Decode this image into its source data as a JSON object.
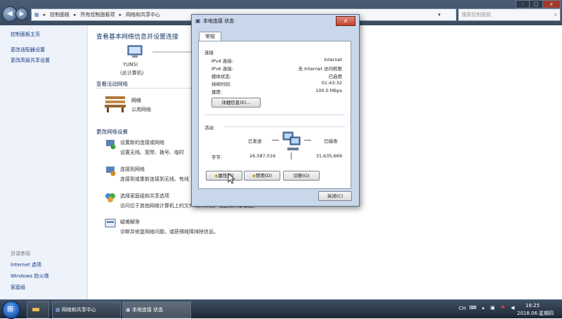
{
  "window": {
    "title_buttons": [
      "-",
      "□",
      "x"
    ],
    "breadcrumb": [
      "控制面板",
      "所有控制面板项",
      "网络和共享中心"
    ],
    "search_placeholder": "搜索控制面板"
  },
  "left_pane": {
    "links": [
      "控制面板主页",
      "更改适配器设置",
      "更改高级共享设置"
    ],
    "see_also_title": "另请参阅",
    "see_also": [
      "Internet 选项",
      "Windows 防火墙",
      "家庭组"
    ]
  },
  "main": {
    "title": "查看基本网络信息并设置连接",
    "computer_name": "YUNSI",
    "computer_sub": "(此计算机)",
    "active_title": "查看活动网络",
    "network_name": "网络",
    "network_type": "公用网络",
    "change_title": "更改网络设置",
    "tasks": [
      {
        "title": "设置新的连接或网络",
        "desc": "设置无线、宽带、拨号、临时"
      },
      {
        "title": "连接到网络",
        "desc": "连接到或重新连接到无线、有线"
      },
      {
        "title": "选择家庭组和共享选项",
        "desc": "访问位于其他网络计算机上的文件和打印机，或更改共享设置。"
      },
      {
        "title": "疑难解答",
        "desc": "诊断并修复网络问题，或获得故障排除信息。"
      }
    ]
  },
  "dialog": {
    "title": "本地连接 状态",
    "close_glyph": "x",
    "tab": "常规",
    "connection_title": "连接",
    "rows": [
      {
        "label": "IPv4 连接:",
        "value": "Internet"
      },
      {
        "label": "IPv6 连接:",
        "value": "无 Internet 访问权限"
      },
      {
        "label": "媒体状态:",
        "value": "已启用"
      },
      {
        "label": "持续时间:",
        "value": "01:43:32"
      },
      {
        "label": "速度:",
        "value": "100.0 Mbps"
      }
    ],
    "details_button": "详细信息(E)...",
    "activity_title": "活动",
    "sent_label": "已发送",
    "received_label": "已接收",
    "bytes_label": "字节:",
    "bytes_sent": "26,587,016",
    "bytes_received": "31,635,669",
    "properties_button": "属性(P)",
    "disable_button": "禁用(D)",
    "diagnose_button": "诊断(G)",
    "close_button": "关闭(C)"
  },
  "taskbar": {
    "items": [
      "网络和共享中心",
      "本地连接 状态"
    ],
    "lang": "CH",
    "time": "16:25",
    "date": "2018.06.星期四"
  }
}
